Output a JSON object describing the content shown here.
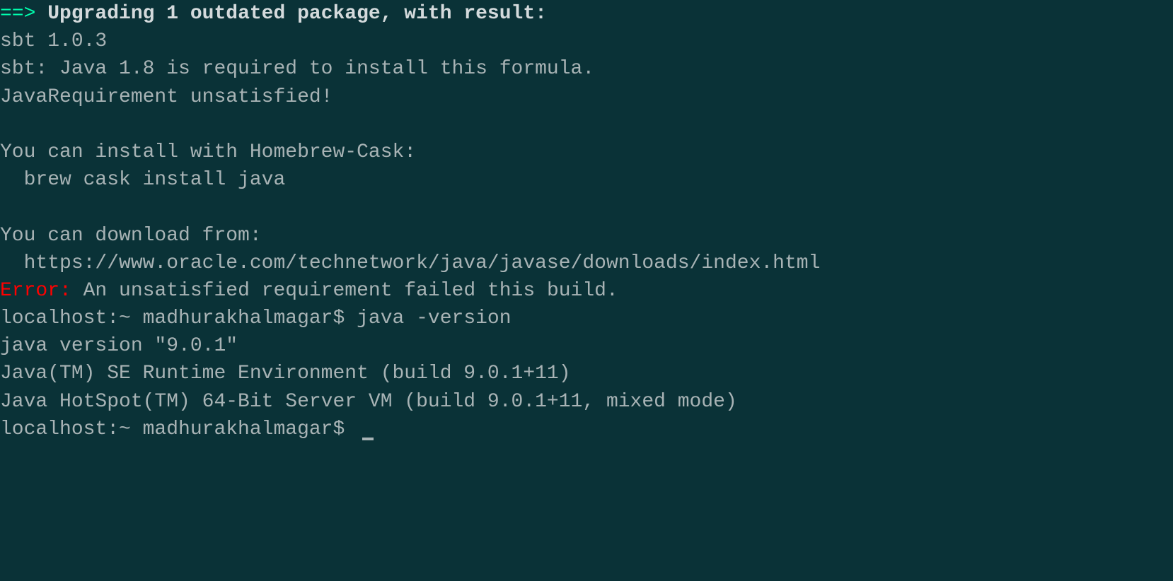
{
  "terminal": {
    "arrow": "==>",
    "header": " Upgrading 1 outdated package, with result:",
    "lines": [
      "sbt 1.0.3",
      "sbt: Java 1.8 is required to install this formula.",
      "JavaRequirement unsatisfied!",
      "",
      "You can install with Homebrew-Cask:",
      "  brew cask install java",
      "",
      "You can download from:",
      "  https://www.oracle.com/technetwork/java/javase/downloads/index.html"
    ],
    "errorLabel": "Error:",
    "errorMessage": " An unsatisfied requirement failed this build.",
    "prompt1": "localhost:~ madhurakhalmagar$ ",
    "command1": "java -version",
    "javaOutput": [
      "java version \"9.0.1\"",
      "Java(TM) SE Runtime Environment (build 9.0.1+11)",
      "Java HotSpot(TM) 64-Bit Server VM (build 9.0.1+11, mixed mode)"
    ],
    "prompt2": "localhost:~ madhurakhalmagar$ "
  }
}
